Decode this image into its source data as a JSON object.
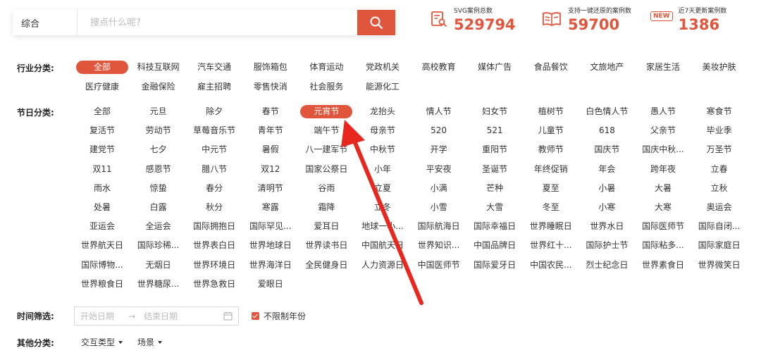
{
  "search": {
    "type_label": "综合",
    "placeholder": "搜点什么呢?"
  },
  "stats": [
    {
      "label": "SVG案例总数",
      "value": "529794"
    },
    {
      "label": "支持一键还原的案例数",
      "value": "59700"
    },
    {
      "badge": "NEW",
      "label": "近7天更新案例数",
      "value": "1386"
    }
  ],
  "industry": {
    "label": "行业分类:",
    "active_index": 0,
    "items": [
      "全部",
      "科技互联网",
      "汽车交通",
      "服饰箱包",
      "体育运动",
      "党政机关",
      "高校教育",
      "媒体广告",
      "食品餐饮",
      "文旅地产",
      "家居生活",
      "美妆护肤",
      "医疗健康",
      "金融保险",
      "雇主招聘",
      "零售快消",
      "社会服务",
      "能源化工"
    ]
  },
  "festival": {
    "label": "节日分类:",
    "active_index": 4,
    "items": [
      "全部",
      "元旦",
      "除夕",
      "春节",
      "元宵节",
      "龙抬头",
      "情人节",
      "妇女节",
      "植树节",
      "白色情人节",
      "愚人节",
      "寒食节",
      "复活节",
      "劳动节",
      "草莓音乐节",
      "青年节",
      "端午节",
      "母亲节",
      "520",
      "521",
      "儿童节",
      "618",
      "父亲节",
      "毕业季",
      "建党节",
      "七夕",
      "中元节",
      "暑假",
      "八一建军节",
      "中秋节",
      "开学",
      "重阳节",
      "教师节",
      "国庆节",
      "国庆中秋...",
      "万圣节",
      "双11",
      "感恩节",
      "腊八节",
      "双12",
      "国家公祭日",
      "小年",
      "平安夜",
      "圣诞节",
      "年终促销",
      "年会",
      "跨年夜",
      "立春",
      "雨水",
      "惊蛰",
      "春分",
      "清明节",
      "谷雨",
      "立夏",
      "小满",
      "芒种",
      "夏至",
      "小暑",
      "大暑",
      "立秋",
      "处暑",
      "白露",
      "秋分",
      "寒露",
      "霜降",
      "立冬",
      "小雪",
      "大雪",
      "冬至",
      "小寒",
      "大寒",
      "奥运会",
      "亚运会",
      "全运会",
      "国际拥抱日",
      "国际罕见...",
      "爱耳日",
      "地球一小...",
      "国际航海日",
      "国际幸福日",
      "世界睡眠日",
      "世界水日",
      "国际医师节",
      "国际自闭...",
      "世界航天日",
      "国际珍稀...",
      "世界表白日",
      "世界地球日",
      "世界读书日",
      "中国航天日",
      "世界知识...",
      "中国品牌日",
      "世界红十...",
      "国际护士节",
      "国际粘多...",
      "国际家庭日",
      "国际博物...",
      "无烟日",
      "世界环境日",
      "世界海洋日",
      "全民健身日",
      "人力资源日",
      "中国医师节",
      "国际爱牙日",
      "中国农民...",
      "烈士纪念日",
      "世界素食日",
      "世界微笑日",
      "世界粮食日",
      "世界糖尿...",
      "世界急救日",
      "爱眼日"
    ]
  },
  "time": {
    "label": "时间筛选:",
    "start_placeholder": "开始日期",
    "arrow": "→",
    "end_placeholder": "结束日期",
    "unlimited_label": "不限制年份",
    "unlimited_checked": true
  },
  "other": {
    "label": "其他分类:",
    "dropdowns": [
      "交互类型",
      "场景"
    ]
  },
  "accent_color": "#e0563c"
}
